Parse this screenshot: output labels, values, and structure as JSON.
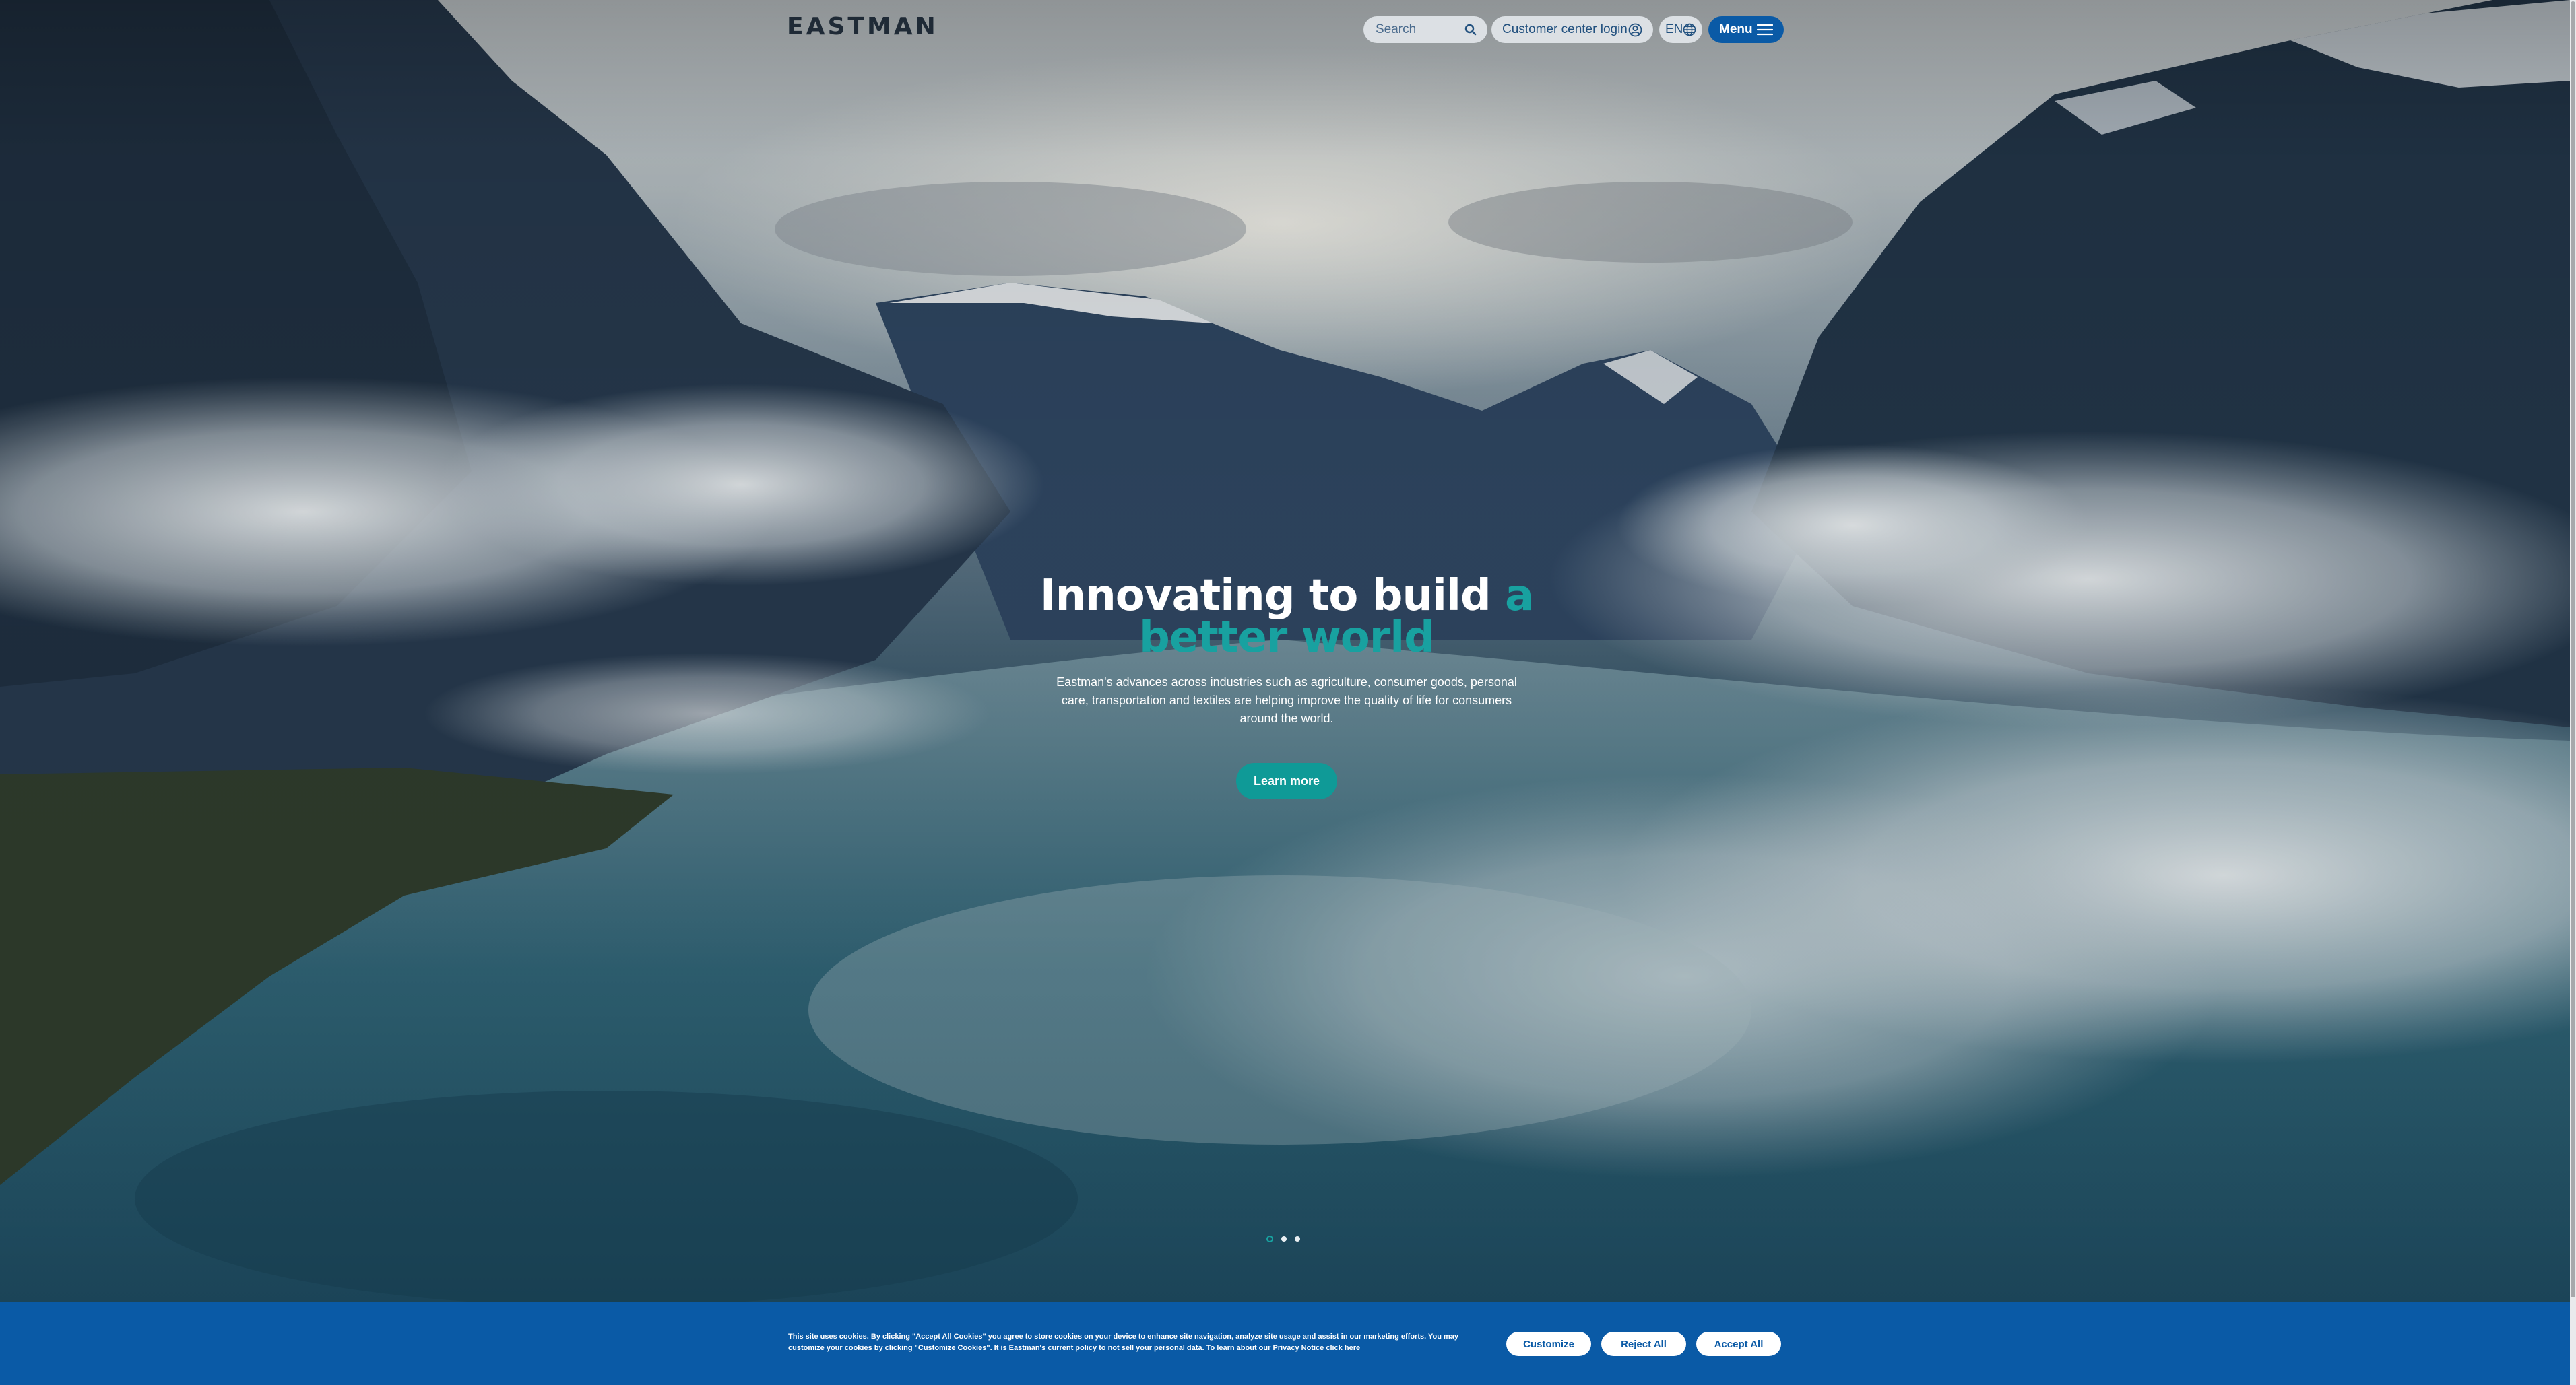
{
  "header": {
    "logo_text": "EASTMAN",
    "search": {
      "placeholder": "Search",
      "icon": "search-icon"
    },
    "login_label": "Customer center login",
    "login_icon": "user-circle-icon",
    "language": "EN",
    "language_icon": "globe-icon",
    "menu_label": "Menu",
    "menu_icon": "hamburger-icon"
  },
  "hero": {
    "title_main": "Innovating to build ",
    "title_accent": "a better world",
    "description": "Eastman's advances across industries such as agriculture, consumer goods, personal care, transportation and textiles are helping improve the quality of life for consumers around the world.",
    "cta_label": "Learn more",
    "slides": {
      "count": 3,
      "active_index": 0
    }
  },
  "cookie_banner": {
    "text": "This site uses cookies. By clicking \"Accept All Cookies\" you agree to store cookies on your device to enhance site navigation, analyze site usage and assist in our marketing efforts. You may customize your cookies by clicking \"Customize Cookies\". It is Eastman's current policy to not sell your personal data. To learn about our Privacy Notice click",
    "link_label": "here",
    "customize_label": "Customize",
    "reject_label": "Reject All",
    "accept_label": "Accept All"
  },
  "colors": {
    "brand_blue": "#0a5aa6",
    "accent_teal": "#18a1a0",
    "button_teal": "#0f9a97"
  }
}
